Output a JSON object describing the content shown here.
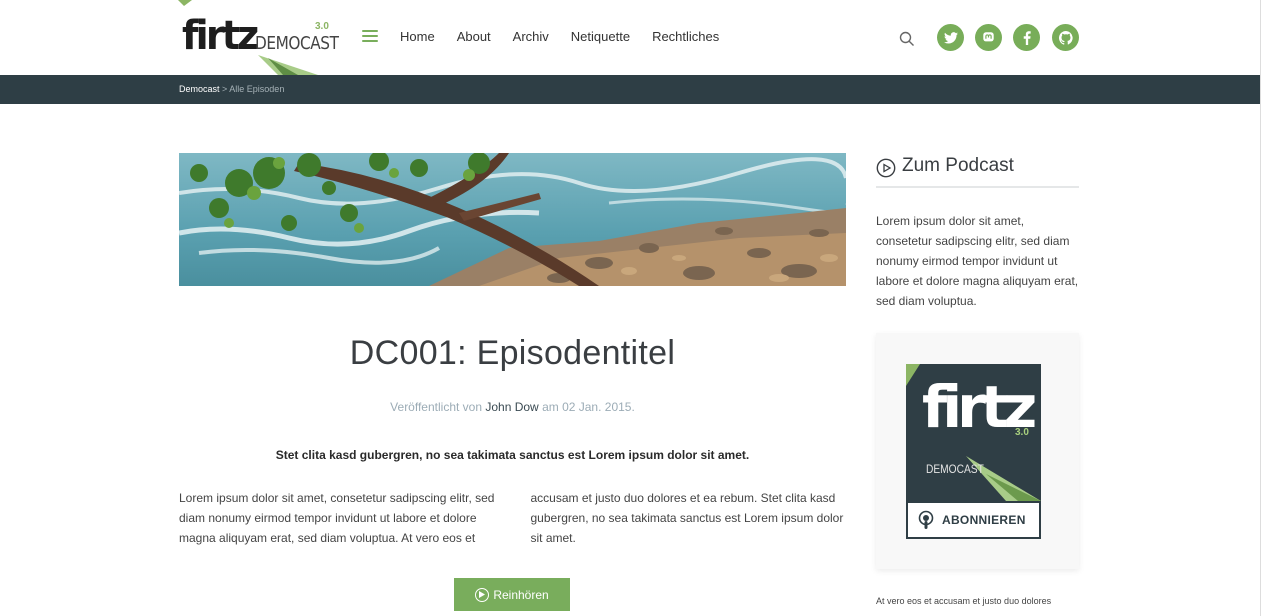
{
  "header": {
    "logo": {
      "wordmark": "firtz",
      "subtitle_a": "DEMO",
      "subtitle_b": "CAST",
      "version": "3.0"
    },
    "nav": [
      "Home",
      "About",
      "Archiv",
      "Netiquette",
      "Rechtliches"
    ],
    "social": [
      {
        "name": "twitter",
        "glyph": "t"
      },
      {
        "name": "mastodon",
        "glyph": "m"
      },
      {
        "name": "facebook",
        "glyph": "f"
      },
      {
        "name": "github",
        "glyph": "g"
      }
    ],
    "accent_color": "#79ad5c"
  },
  "breadcrumb": {
    "home": "Democast",
    "separator": " > ",
    "current": "Alle Episoden"
  },
  "episode": {
    "title": "DC001: Episodentitel",
    "meta_prefix": "Veröffentlicht von ",
    "author": "John Dow",
    "meta_mid": " am ",
    "date": "02 Jan. 2015.",
    "lead": "Stet clita kasd gubergren, no sea takimata sanctus est Lorem ipsum dolor sit amet.",
    "body": "Lorem ipsum dolor sit amet, consetetur sadipscing elitr, sed diam nonumy eirmod tempor invidunt ut labore et dolore magna aliquyam erat, sed diam voluptua. At vero eos et accusam et justo duo dolores et ea rebum. Stet clita kasd gubergren, no sea takimata sanctus est Lorem ipsum dolor sit amet.",
    "listen_label": "Reinhören"
  },
  "sidebar": {
    "title": "Zum Podcast",
    "text": "Lorem ipsum dolor sit amet, consetetur sadipscing elitr, sed diam nonumy eirmod tempor invidunt ut labore et dolore magna aliquyam erat, sed diam voluptua.",
    "cover": {
      "wordmark": "firtz",
      "version": "3.0",
      "democast": "DEMOCAST"
    },
    "subscribe_label": "ABONNIEREN",
    "footer_text": "At vero eos et accusam et justo duo dolores"
  }
}
